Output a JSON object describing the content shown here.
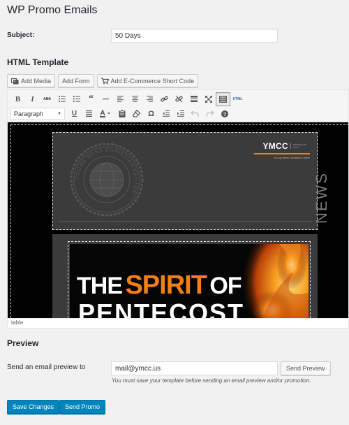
{
  "page": {
    "title": "WP Promo Emails"
  },
  "subject": {
    "label": "Subject:",
    "value": "50 Days"
  },
  "template_section": {
    "title": "HTML Template"
  },
  "media_buttons": {
    "add_media": "Add Media",
    "add_form": "Add Form",
    "add_ecommerce": "Add E-Commerce Short Code"
  },
  "toolbar": {
    "row1": [
      "bold-icon",
      "italic-icon",
      "strikethrough-icon",
      "bullet-list-icon",
      "numbered-list-icon",
      "blockquote-icon",
      "horizontal-line-icon",
      "align-left-icon",
      "align-center-icon",
      "align-right-icon",
      "insert-link-icon",
      "remove-link-icon",
      "read-more-icon",
      "fullscreen-icon",
      "toolbar-toggle-icon"
    ],
    "html_tab": "HTML",
    "format_select": "Paragraph",
    "row2": [
      "underline-icon",
      "justify-icon",
      "text-color-icon",
      "paste-text-icon",
      "clear-formatting-icon",
      "special-character-icon",
      "outdent-icon",
      "indent-icon",
      "undo-icon",
      "redo-icon",
      "help-icon"
    ]
  },
  "newsletter": {
    "brand": "YMCC",
    "brand_tag": "MAKINGS OF FAITH",
    "brand_sub": "Young Mens Christian Center",
    "seal_text": "YOUNG MENS CHRISTIAN CENTER",
    "news_label": "NEWS",
    "hero_the": "THE",
    "hero_spirit": "SPIRIT",
    "hero_of": "OF",
    "hero_line2": "PENTECOST"
  },
  "editor_status": "table",
  "preview": {
    "title": "Preview",
    "label": "Send an email preview to",
    "email_value": "mail@ymcc.us",
    "send_button": "Send Preview",
    "note": "You must save your template before sending an email preview and/or promotion."
  },
  "actions": {
    "save": "Save Changes",
    "send_promo": "Send Promo"
  },
  "colors": {
    "primary": "#0085ba",
    "accent_orange": "#f07f14",
    "background": "#f1f1f1"
  }
}
